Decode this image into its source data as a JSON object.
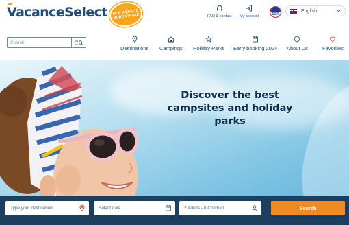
{
  "brand": {
    "logo_text": "VacanceSelect",
    "badge_line1": "NEW WEBSITE",
    "badge_line2": "MORE CHOICE",
    "accent_color": "#f7941d",
    "primary_color": "#1f4e7a"
  },
  "utility": {
    "faq_label": "FAQ & contact",
    "faq_icon": "headset-icon",
    "account_label": "My account",
    "account_icon": "login-icon",
    "sgr_text": "SGR"
  },
  "language": {
    "selected": "English",
    "flag": "uk-flag-icon"
  },
  "search": {
    "placeholder": "Search"
  },
  "nav": [
    {
      "label": "Destinations",
      "icon": "location-pin-icon"
    },
    {
      "label": "Campings",
      "icon": "home-icon"
    },
    {
      "label": "Holiday Parks",
      "icon": "star-icon"
    },
    {
      "label": "Early booking 2024",
      "icon": "calendar-icon"
    },
    {
      "label": "About Us",
      "icon": "smiley-icon"
    },
    {
      "label": "Favorites",
      "icon": "heart-icon"
    }
  ],
  "hero": {
    "title_line1": "Discover the best",
    "title_line2": "campsites and holiday",
    "title_line3": "parks"
  },
  "booking": {
    "destination_placeholder": "Type your destination",
    "date_placeholder": "Select date",
    "persons_value": "2 Adults - 0 Children",
    "search_label": "Search",
    "button_color": "#f08a23",
    "bar_color": "#1c3f5f"
  }
}
